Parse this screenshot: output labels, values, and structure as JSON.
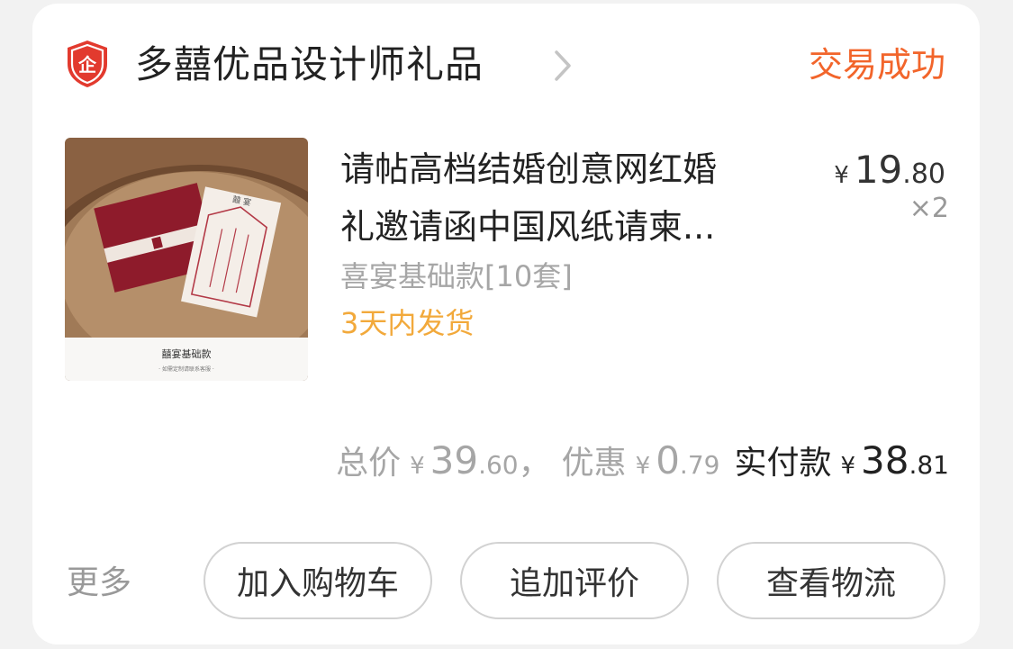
{
  "store": {
    "badge_text": "企",
    "name": "多囍优品设计师礼品",
    "status": "交易成功"
  },
  "product": {
    "title_line1": "请帖高档结婚创意网红婚",
    "title_line2": "礼邀请函中国风纸请柬...",
    "spec": "喜宴基础款[10套]",
    "shipping": "3天内发货",
    "image_caption": "囍宴基础款",
    "image_subcaption": "· 如需定制请联系客服 ·",
    "image_card_text": "囍 宴",
    "price_symbol": "¥",
    "price_int": "19",
    "price_dec": ".80",
    "quantity": "×2"
  },
  "summary": {
    "total_label": "总价",
    "symbol": "¥",
    "total_int": "39",
    "total_dec": ".60",
    "separator": "，",
    "discount_label": "优惠",
    "discount_int": "0",
    "discount_dec": ".79",
    "paid_label": "实付款",
    "paid_int": "38",
    "paid_dec": ".81"
  },
  "actions": {
    "more_label": "更多",
    "add_cart_label": "加入购物车",
    "review_label": "追加评价",
    "logistics_label": "查看物流"
  },
  "colors": {
    "status_orange": "#f2652b",
    "shipping_orange": "#f2a93b",
    "badge_red": "#e23a2e"
  },
  "icons": {
    "store_badge": "shield-icon",
    "store_chevron": "chevron-right-icon"
  }
}
